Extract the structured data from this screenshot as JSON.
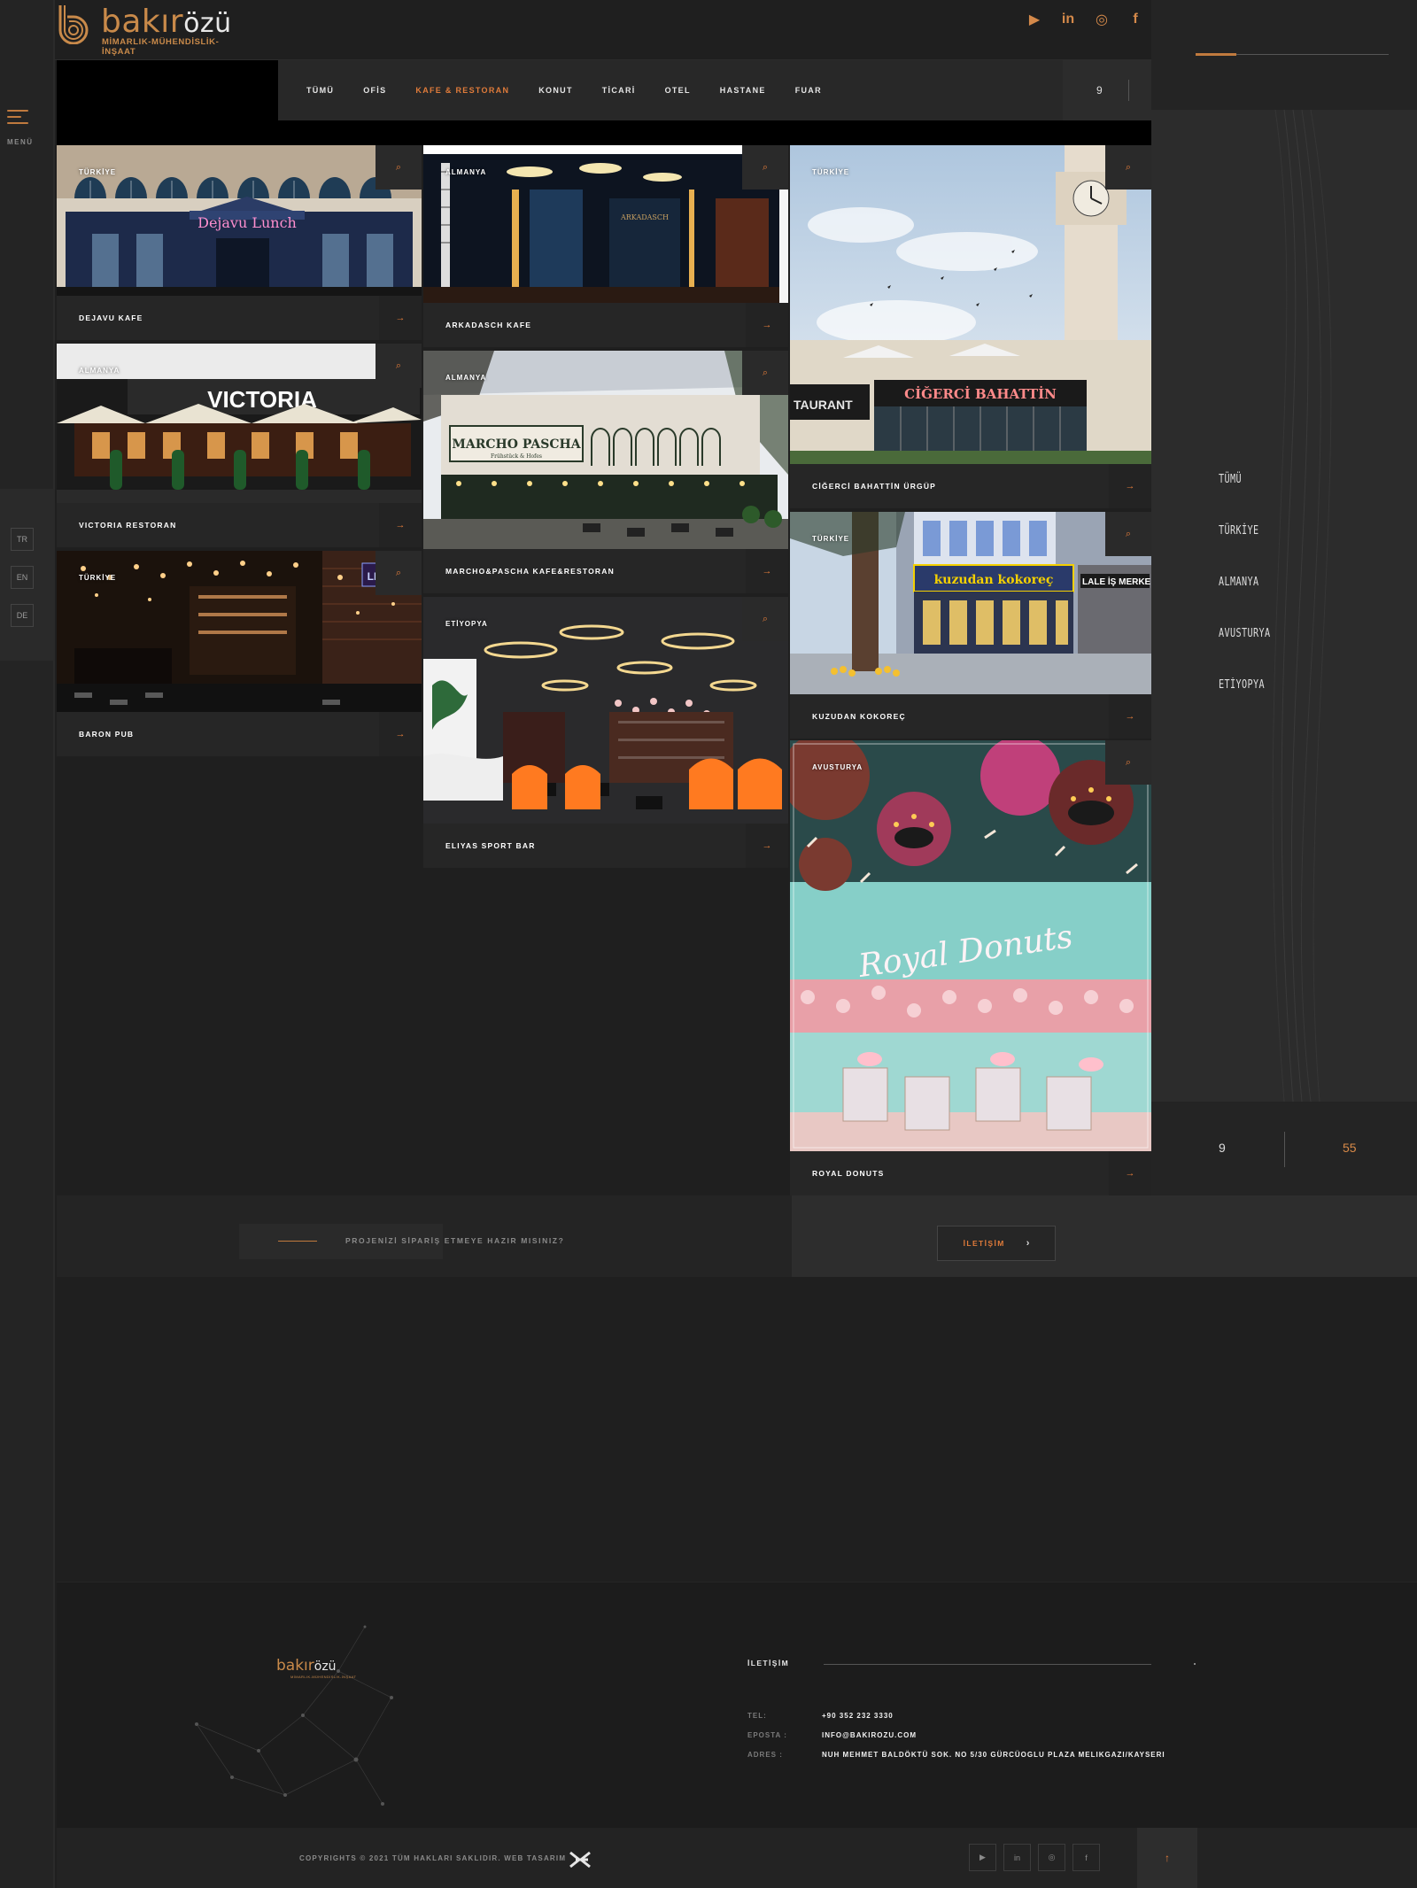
{
  "brand": {
    "name_main": "bakır",
    "name_accent": "özü",
    "tagline": "MİMARLIK-MÜHENDİSLİK-İNŞAAT"
  },
  "left_rail": {
    "menu_label": "MENÜ",
    "languages": [
      "TR",
      "EN",
      "DE"
    ]
  },
  "social": {
    "icons": [
      "youtube-icon",
      "linkedin-icon",
      "instagram-icon",
      "facebook-icon"
    ],
    "youtube": "▶",
    "linkedin": "in",
    "instagram": "◎",
    "facebook": "f"
  },
  "filters": {
    "items": [
      "TÜMÜ",
      "OFİS",
      "KAFE & RESTORAN",
      "KONUT",
      "TİCARİ",
      "OTEL",
      "HASTANE",
      "FUAR"
    ],
    "active": "KAFE & RESTORAN",
    "count": "9"
  },
  "sidebar": {
    "countries": [
      "TÜMÜ",
      "TÜRKİYE",
      "ALMANYA",
      "AVUSTURYA",
      "ETİYOPYA"
    ],
    "current": "9",
    "total": "55",
    "progress_fraction": 0.21
  },
  "projects": [
    {
      "country": "TÜRKİYE",
      "title": "DEJAVU KAFE"
    },
    {
      "country": "ALMANYA",
      "title": "VICTORIA RESTORAN"
    },
    {
      "country": "TÜRKİYE",
      "title": "BARON PUB"
    },
    {
      "country": "ALMANYA",
      "title": "ARKADASCH KAFE"
    },
    {
      "country": "ALMANYA",
      "title": "MARCHO&PASCHA KAFE&RESTORAN"
    },
    {
      "country": "ETİYOPYA",
      "title": "ELIYAS SPORT BAR"
    },
    {
      "country": "TÜRKİYE",
      "title": "CİĞERCİ BAHATTİN ÜRGÜP"
    },
    {
      "country": "TÜRKİYE",
      "title": "KUZUDAN KOKOREÇ"
    },
    {
      "country": "AVUSTURYA",
      "title": "ROYAL DONUTS"
    }
  ],
  "image_signs": {
    "dejavu": "Dejavu Lunch",
    "victoria": "VICTORIA",
    "baron": "LIQUORS",
    "arkadasch": "ARKADASCH",
    "marcho": "MARCHO PASCHA",
    "marcho_sub": "Frühstück & Hofes",
    "cigerci": "CİĞERCİ BAHATTİN",
    "cigerci_side": "TAURANT",
    "kuzudan": "kuzudan kokoreç",
    "kuzudan_side": "LALE İŞ MERKE",
    "donuts": "Royal Donuts"
  },
  "icons": {
    "zoom": "⌕",
    "arrow": "→",
    "chevron": "›",
    "up": "↑"
  },
  "cta": {
    "text": "PROJENİZİ SİPARİŞ ETMEYE HAZIR MISINIZ?",
    "button": "İLETİŞİM"
  },
  "footer": {
    "contact_heading": "İLETİŞİM",
    "rows": [
      {
        "label": "TEL:",
        "value": "+90 352 232 3330"
      },
      {
        "label": "EPOSTA :",
        "value": "INFO@BAKIROZU.COM"
      },
      {
        "label": "ADRES :",
        "value": "NUH MEHMET BALDÖKTÜ SOK. NO 5/30 GÜRCÜOGLU PLAZA MELIKGAZI/KAYSERI"
      }
    ],
    "copyright": "COPYRIGHTS © 2021 TÜM HAKLARI SAKLIDIR. WEB TASARIM"
  },
  "colors": {
    "accent": "#e07b3a",
    "brand_copper": "#c98a4a",
    "bg": "#1f1f1f"
  }
}
